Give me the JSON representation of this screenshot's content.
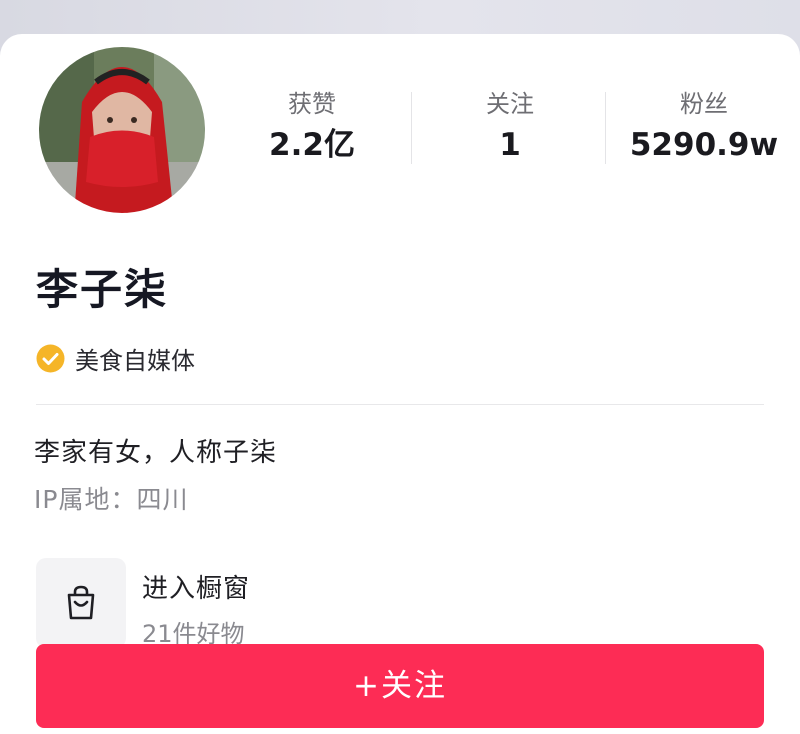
{
  "profile": {
    "name": "李子柒",
    "verification": "美食自媒体",
    "bio": "李家有女，人称子柒",
    "ip_location": "IP属地：四川"
  },
  "stats": [
    {
      "label": "获赞",
      "value": "2.2亿"
    },
    {
      "label": "关注",
      "value": "1"
    },
    {
      "label": "粉丝",
      "value": "5290.9w"
    }
  ],
  "shop": {
    "title": "进入橱窗",
    "subtitle": "21件好物",
    "icon": "shopping-bag-icon"
  },
  "actions": {
    "follow_label": "+关注"
  },
  "colors": {
    "accent": "#fd2c55",
    "verify_badge": "#f5b528",
    "background": "#ffffff"
  }
}
